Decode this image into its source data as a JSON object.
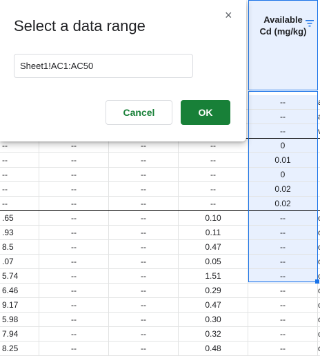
{
  "dialog": {
    "title": "Select a data range",
    "close_glyph": "×",
    "range_value": "Sheet1!AC1:AC50",
    "cancel_label": "Cancel",
    "ok_label": "OK"
  },
  "column_header": {
    "line1": "Available",
    "line2": "Cd (mg/kg)",
    "filter_icon": "filter-icon"
  },
  "rows_under_dialog": [
    {
      "c4": "--",
      "c5": "a"
    },
    {
      "c4": "--",
      "c5": "a"
    },
    {
      "c4": "--",
      "c5": "v"
    }
  ],
  "rows": [
    {
      "c0": "--",
      "c1": "--",
      "c2": "--",
      "c3": "--",
      "c4": "0",
      "c5": ""
    },
    {
      "c0": "--",
      "c1": "--",
      "c2": "--",
      "c3": "--",
      "c4": "0.01",
      "c5": ""
    },
    {
      "c0": "--",
      "c1": "--",
      "c2": "--",
      "c3": "--",
      "c4": "0",
      "c5": ""
    },
    {
      "c0": "--",
      "c1": "--",
      "c2": "--",
      "c3": "--",
      "c4": "0.02",
      "c5": ""
    },
    {
      "c0": "--",
      "c1": "--",
      "c2": "--",
      "c3": "--",
      "c4": "0.02",
      "c5": ""
    },
    {
      "c0": ".65",
      "c1": "--",
      "c2": "--",
      "c3": "0.10",
      "c4": "--",
      "c5": "c"
    },
    {
      "c0": ".93",
      "c1": "--",
      "c2": "--",
      "c3": "0.11",
      "c4": "--",
      "c5": "c"
    },
    {
      "c0": "8.5",
      "c1": "--",
      "c2": "--",
      "c3": "0.47",
      "c4": "--",
      "c5": "c"
    },
    {
      "c0": ".07",
      "c1": "--",
      "c2": "--",
      "c3": "0.05",
      "c4": "--",
      "c5": "c"
    },
    {
      "c0": "5.74",
      "c1": "--",
      "c2": "--",
      "c3": "1.51",
      "c4": "--",
      "c5": "c"
    },
    {
      "c0": "6.46",
      "c1": "--",
      "c2": "--",
      "c3": "0.29",
      "c4": "--",
      "c5": "c"
    },
    {
      "c0": "9.17",
      "c1": "--",
      "c2": "--",
      "c3": "0.47",
      "c4": "--",
      "c5": "c"
    },
    {
      "c0": "5.98",
      "c1": "--",
      "c2": "--",
      "c3": "0.30",
      "c4": "--",
      "c5": "c"
    },
    {
      "c0": "7.94",
      "c1": "--",
      "c2": "--",
      "c3": "0.32",
      "c4": "--",
      "c5": "c"
    },
    {
      "c0": "8.25",
      "c1": "--",
      "c2": "--",
      "c3": "0.48",
      "c4": "--",
      "c5": "c"
    }
  ],
  "colors": {
    "accent": "#1a73e8",
    "selection_fill": "#e8f0fe",
    "ok_green": "#188038"
  }
}
